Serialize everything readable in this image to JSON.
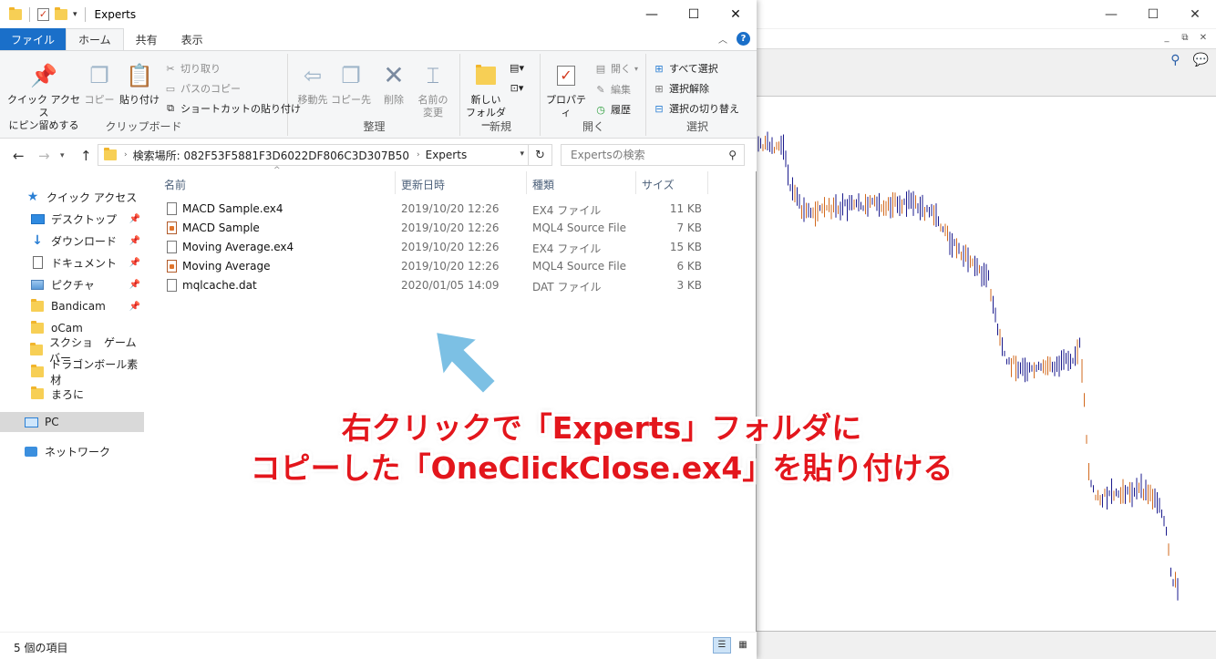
{
  "background_app": {
    "window_controls": [
      "—",
      "☐",
      "✕"
    ],
    "mdi_controls": [
      "_",
      "⧉",
      "✕"
    ]
  },
  "explorer": {
    "title": "Experts",
    "window_controls": {
      "minimize": "—",
      "maximize": "☐",
      "close": "✕"
    },
    "ribbon_tabs": [
      {
        "label": "ファイル"
      },
      {
        "label": "ホーム"
      },
      {
        "label": "共有"
      },
      {
        "label": "表示"
      }
    ],
    "help": "?",
    "ribbon": {
      "clipboard": {
        "group_label": "クリップボード",
        "pin": "クイック アクセス\nにピン留めする",
        "copy": "コピー",
        "paste": "貼り付け",
        "cut": "切り取り",
        "copy_path": "パスのコピー",
        "paste_shortcut": "ショートカットの貼り付け"
      },
      "organize": {
        "group_label": "整理",
        "move_to": "移動先",
        "copy_to": "コピー先",
        "delete": "削除",
        "rename": "名前の\n変更"
      },
      "new": {
        "group_label": "新規",
        "new_folder": "新しい\nフォルダー"
      },
      "open": {
        "group_label": "開く",
        "properties": "プロパティ",
        "open": "開く",
        "edit": "編集",
        "history": "履歴"
      },
      "select": {
        "group_label": "選択",
        "select_all": "すべて選択",
        "select_none": "選択解除",
        "invert": "選択の切り替え"
      }
    },
    "address": {
      "crumb1": "検索場所: 082F53F5881F3D6022DF806C3D307B50",
      "crumb2": "Experts"
    },
    "search_placeholder": "Expertsの検索",
    "nav": [
      {
        "label": "クイック アクセス",
        "icon": "star-icon"
      },
      {
        "label": "デスクトップ",
        "icon": "desktop-icon",
        "pinned": true
      },
      {
        "label": "ダウンロード",
        "icon": "download-icon",
        "pinned": true
      },
      {
        "label": "ドキュメント",
        "icon": "document-icon",
        "pinned": true
      },
      {
        "label": "ピクチャ",
        "icon": "pictures-icon",
        "pinned": true
      },
      {
        "label": "Bandicam",
        "icon": "folder-icon",
        "pinned": true
      },
      {
        "label": "oCam",
        "icon": "folder-icon"
      },
      {
        "label": "スクショ　ゲームバー",
        "icon": "folder-icon"
      },
      {
        "label": "ドラゴンボール素材",
        "icon": "folder-icon"
      },
      {
        "label": "まろに",
        "icon": "folder-icon"
      },
      {
        "label": "PC",
        "icon": "pc-icon",
        "selected": true
      },
      {
        "label": "ネットワーク",
        "icon": "network-icon"
      }
    ],
    "columns": {
      "name": "名前",
      "date": "更新日時",
      "type": "種類",
      "size": "サイズ"
    },
    "files": [
      {
        "name": "MACD Sample.ex4",
        "date": "2019/10/20 12:26",
        "type": "EX4 ファイル",
        "size": "11 KB",
        "kind": "file"
      },
      {
        "name": "MACD Sample",
        "date": "2019/10/20 12:26",
        "type": "MQL4 Source File",
        "size": "7 KB",
        "kind": "mql"
      },
      {
        "name": "Moving Average.ex4",
        "date": "2019/10/20 12:26",
        "type": "EX4 ファイル",
        "size": "15 KB",
        "kind": "file"
      },
      {
        "name": "Moving Average",
        "date": "2019/10/20 12:26",
        "type": "MQL4 Source File",
        "size": "6 KB",
        "kind": "mql"
      },
      {
        "name": "mqlcache.dat",
        "date": "2020/01/05 14:09",
        "type": "DAT ファイル",
        "size": "3 KB",
        "kind": "file"
      }
    ],
    "status": {
      "count": "5 個の項目"
    }
  },
  "annotation": {
    "line1": "右クリックで「Experts」フォルダに",
    "line2": "コピーした「OneClickClose.ex4」を貼り付ける",
    "color": "#e3161c",
    "arrow_color": "#7cc0e4"
  }
}
